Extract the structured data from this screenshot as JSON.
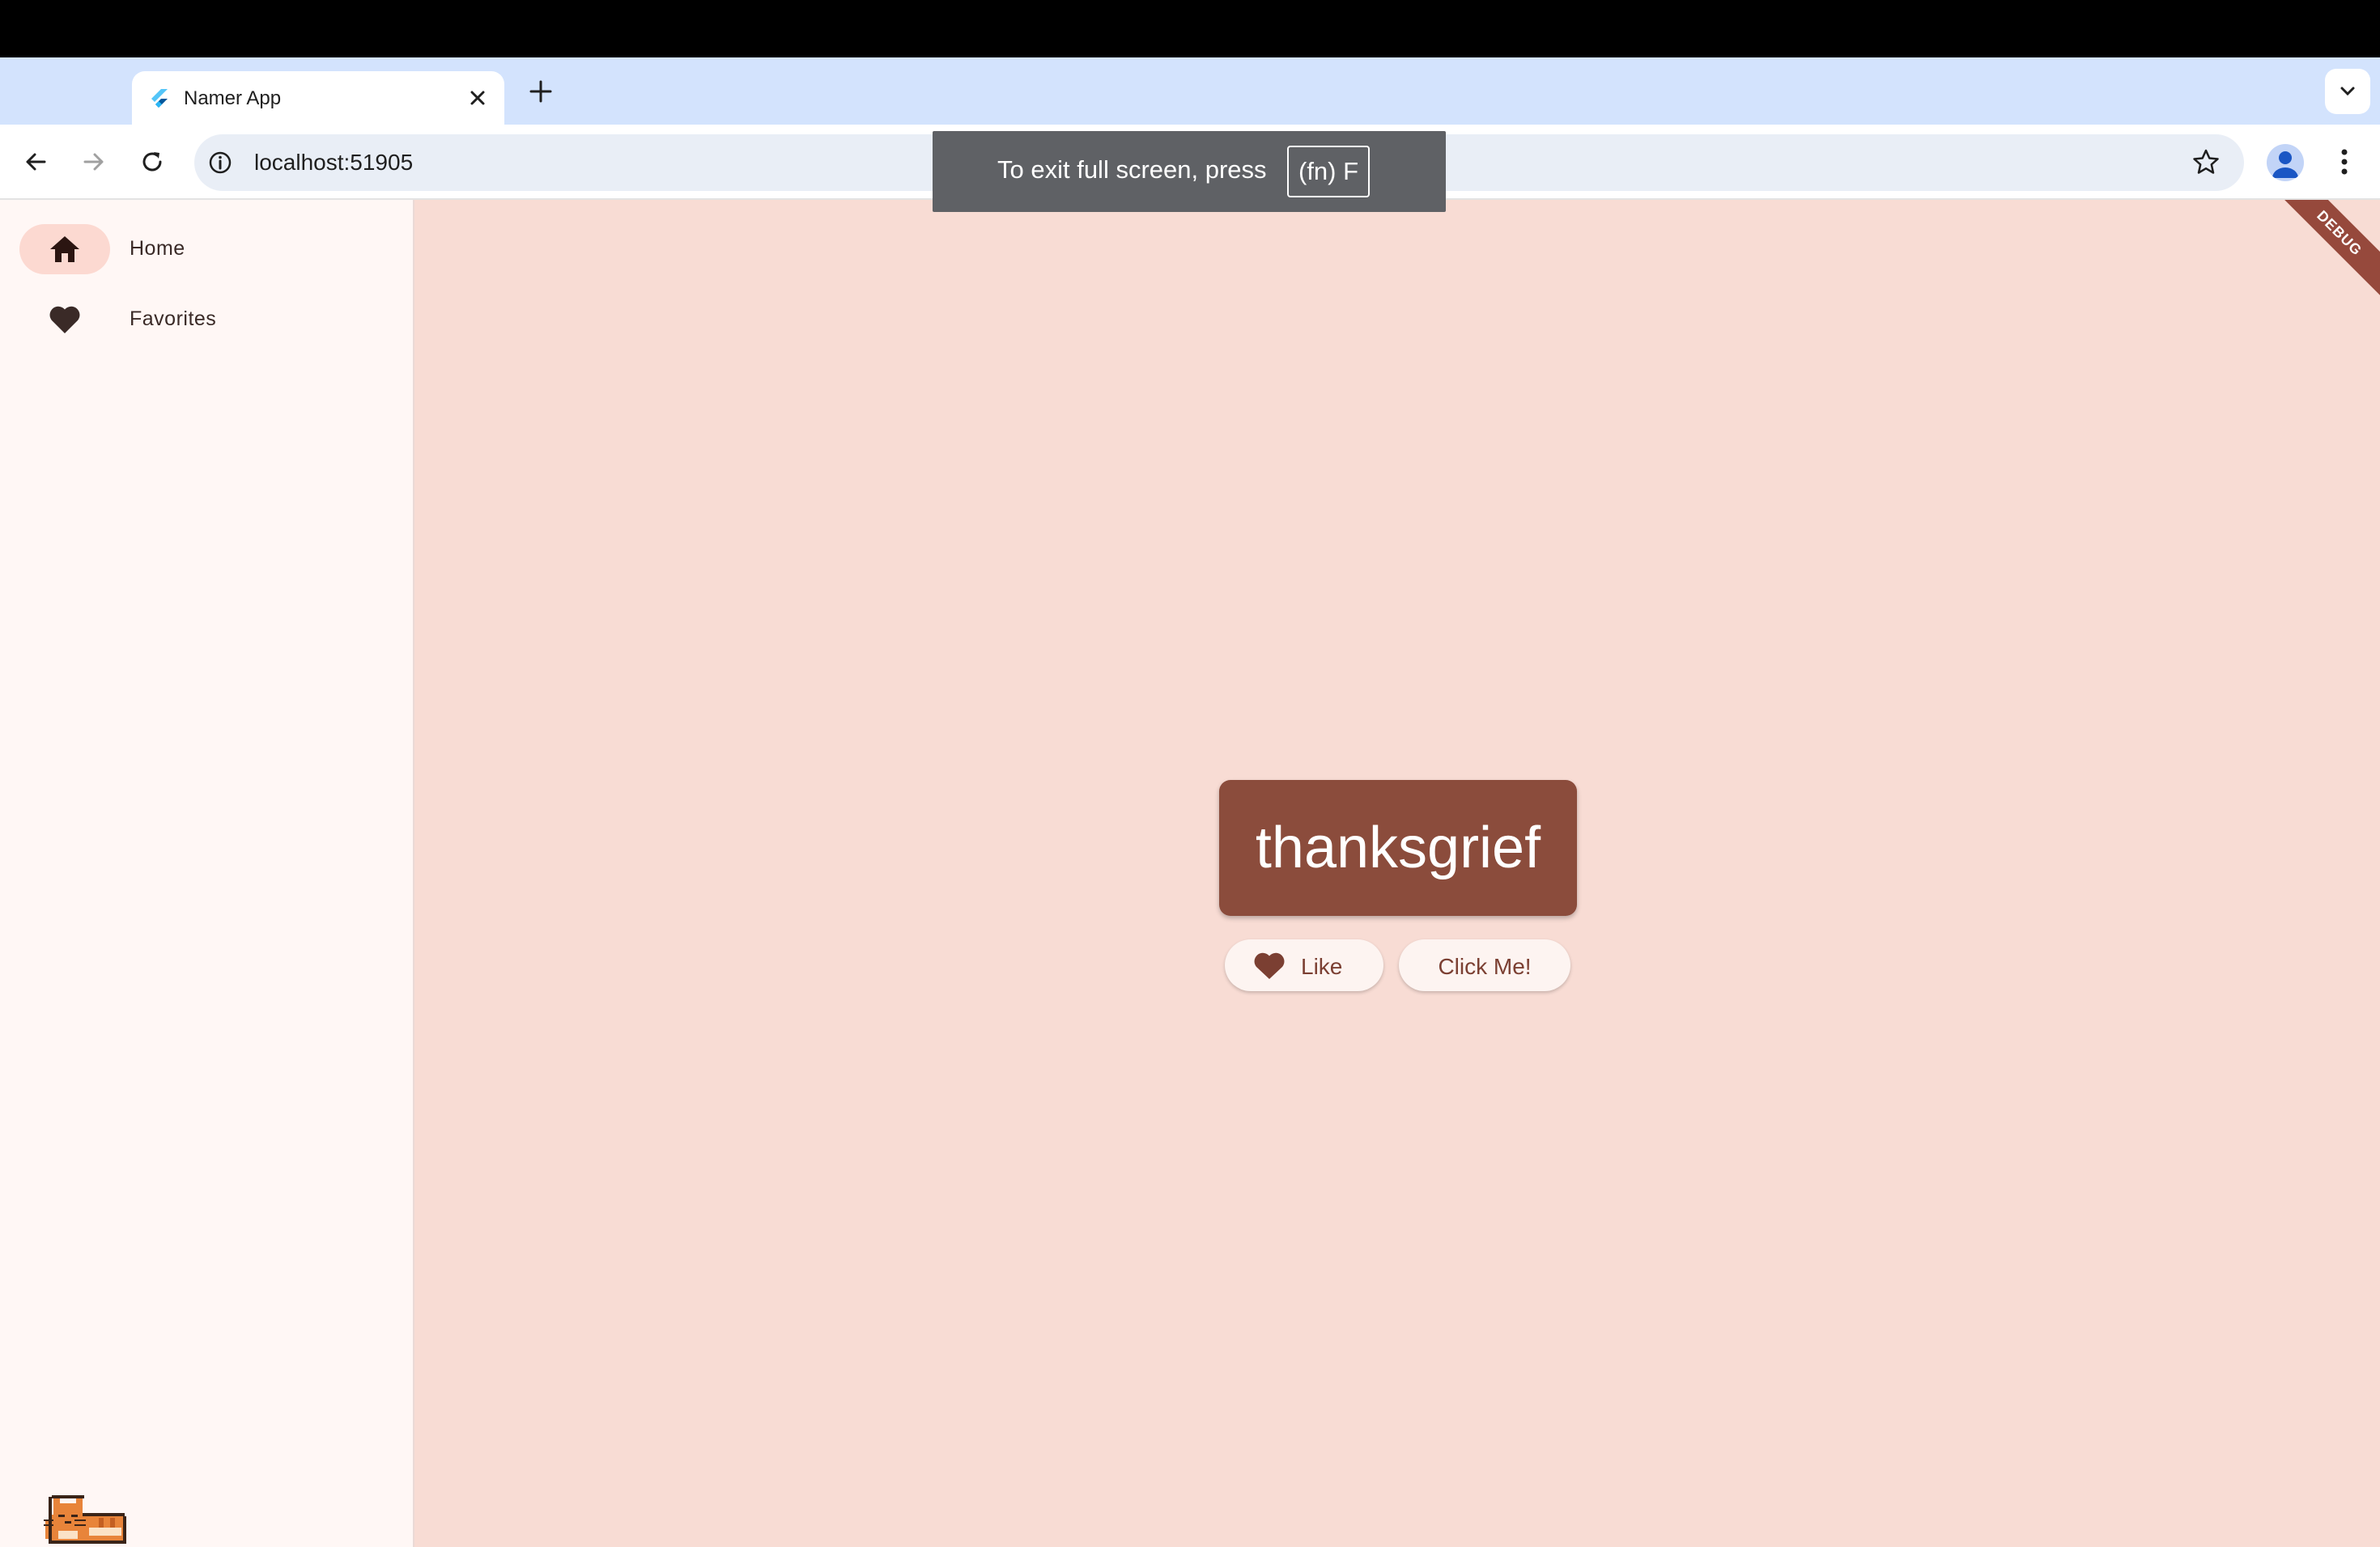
{
  "browser": {
    "tab_title": "Namer App",
    "url": "localhost:51905",
    "fullscreen_toast": {
      "message": "To exit full screen, press",
      "key": "(fn) F"
    }
  },
  "app": {
    "nav": [
      {
        "label": "Home",
        "icon": "home-icon",
        "selected": true
      },
      {
        "label": "Favorites",
        "icon": "heart-icon",
        "selected": false
      }
    ],
    "debug_banner": "DEBUG",
    "current_word": "thanksgrief",
    "like_label": "Like",
    "next_label": "Click Me!",
    "colors": {
      "card": "#8b4c3c",
      "background": "#f8dcd4",
      "rail": "#fff7f5",
      "selected_indicator": "#fcd9d1"
    }
  }
}
